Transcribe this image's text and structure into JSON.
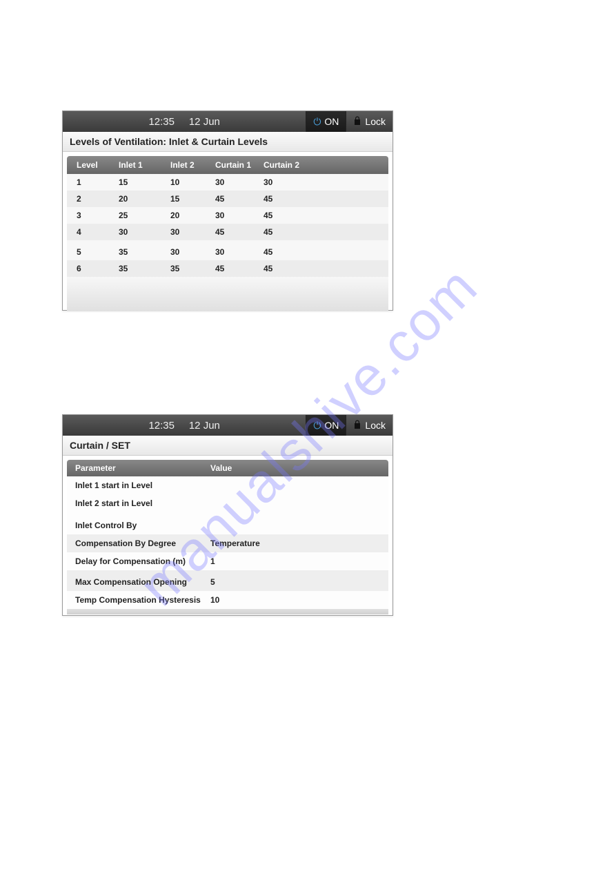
{
  "header": {
    "time": "12:35",
    "date": "12 Jun",
    "on_label": "ON",
    "lock_label": "Lock"
  },
  "panel1": {
    "title": "Levels of Ventilation: Inlet & Curtain Levels",
    "columns": {
      "level": "Level",
      "inlet1": "Inlet 1",
      "inlet2": "Inlet 2",
      "curtain1": "Curtain 1",
      "curtain2": "Curtain 2"
    },
    "rows": [
      {
        "level": "1",
        "inlet1": "15",
        "inlet2": "10",
        "curtain1": "30",
        "curtain2": "30"
      },
      {
        "level": "2",
        "inlet1": "20",
        "inlet2": "15",
        "curtain1": "45",
        "curtain2": "45"
      },
      {
        "level": "3",
        "inlet1": "25",
        "inlet2": "20",
        "curtain1": "30",
        "curtain2": "45"
      },
      {
        "level": "4",
        "inlet1": "30",
        "inlet2": "30",
        "curtain1": "45",
        "curtain2": "45"
      },
      {
        "level": "5",
        "inlet1": "35",
        "inlet2": "30",
        "curtain1": "30",
        "curtain2": "45"
      },
      {
        "level": "6",
        "inlet1": "35",
        "inlet2": "35",
        "curtain1": "45",
        "curtain2": "45"
      }
    ]
  },
  "panel2": {
    "title": "Curtain / SET",
    "columns": {
      "parameter": "Parameter",
      "value": "Value"
    },
    "rows": [
      {
        "param": "Inlet 1 start in Level",
        "value": ""
      },
      {
        "param": "Inlet 2 start in Level",
        "value": ""
      },
      {
        "param": "Inlet Control By",
        "value": ""
      },
      {
        "param": "Compensation By Degree",
        "value": "Temperature"
      },
      {
        "param": "Delay for Compensation (m)",
        "value": "1"
      },
      {
        "param": "Max Compensation Opening",
        "value": "5"
      },
      {
        "param": "Temp Compensation Hysteresis",
        "value": "10"
      }
    ]
  },
  "watermark": "manualshive.com"
}
